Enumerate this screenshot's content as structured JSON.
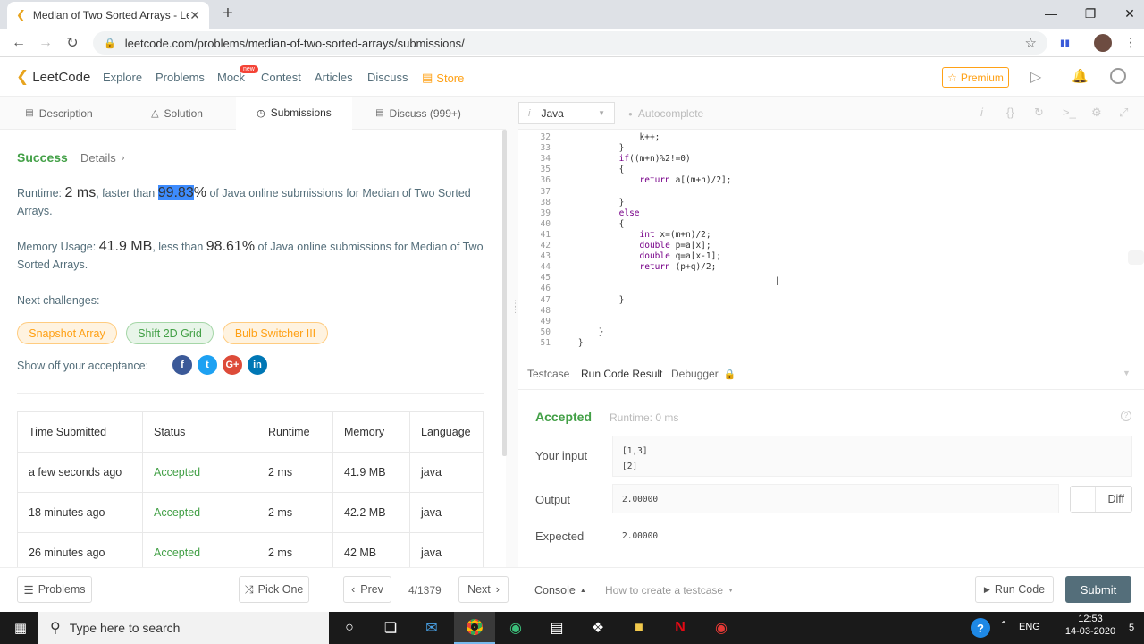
{
  "browser": {
    "tab_title": "Median of Two Sorted Arrays - Le",
    "url": "leetcode.com/problems/median-of-two-sorted-arrays/submissions/"
  },
  "nav": {
    "logo": "LeetCode",
    "explore": "Explore",
    "problems": "Problems",
    "mock": "Mock",
    "badge": "new",
    "contest": "Contest",
    "articles": "Articles",
    "discuss": "Discuss",
    "store": "Store",
    "premium": "Premium"
  },
  "subtabs": {
    "description": "Description",
    "solution": "Solution",
    "submissions": "Submissions",
    "discuss": "Discuss (999+)"
  },
  "editor": {
    "language": "Java",
    "autocomplete": "Autocomplete",
    "lines": [
      {
        "n": "32",
        "t": "                k++;"
      },
      {
        "n": "33",
        "t": "            }"
      },
      {
        "n": "34",
        "t": "            if((m+n)%2!=0)"
      },
      {
        "n": "35",
        "t": "            {"
      },
      {
        "n": "36",
        "t": "                return a[(m+n)/2];"
      },
      {
        "n": "37",
        "t": ""
      },
      {
        "n": "38",
        "t": "            }"
      },
      {
        "n": "39",
        "t": "            else"
      },
      {
        "n": "40",
        "t": "            {"
      },
      {
        "n": "41",
        "t": "                int x=(m+n)/2;"
      },
      {
        "n": "42",
        "t": "                double p=a[x];"
      },
      {
        "n": "43",
        "t": "                double q=a[x-1];"
      },
      {
        "n": "44",
        "t": "                return (p+q)/2;"
      },
      {
        "n": "45",
        "t": ""
      },
      {
        "n": "46",
        "t": ""
      },
      {
        "n": "47",
        "t": "            }"
      },
      {
        "n": "48",
        "t": ""
      },
      {
        "n": "49",
        "t": ""
      },
      {
        "n": "50",
        "t": "        }"
      },
      {
        "n": "51",
        "t": "    }"
      }
    ]
  },
  "result": {
    "success": "Success",
    "details": "Details",
    "runtime_label": "Runtime:",
    "runtime_value": "2 ms",
    "faster_than": ", faster than",
    "runtime_pct": "99.83",
    "pct_sign": "%",
    "runtime_tail": "of Java online submissions for Median of Two Sorted Arrays.",
    "memory_label": "Memory Usage:",
    "memory_value": "41.9 MB",
    "less_than": ", less than",
    "memory_pct": "98.61%",
    "memory_tail": "of Java online submissions for Median of Two Sorted Arrays.",
    "next_challenges": "Next challenges:",
    "challenges": [
      "Snapshot Array",
      "Shift 2D Grid",
      "Bulb Switcher III"
    ],
    "show_off": "Show off your acceptance:"
  },
  "table": {
    "headers": [
      "Time Submitted",
      "Status",
      "Runtime",
      "Memory",
      "Language"
    ],
    "rows": [
      [
        "a few seconds ago",
        "Accepted",
        "2 ms",
        "41.9 MB",
        "java"
      ],
      [
        "18 minutes ago",
        "Accepted",
        "2 ms",
        "42.2 MB",
        "java"
      ],
      [
        "26 minutes ago",
        "Accepted",
        "2 ms",
        "42 MB",
        "java"
      ]
    ]
  },
  "console": {
    "tabs": [
      "Testcase",
      "Run Code Result",
      "Debugger"
    ],
    "status": "Accepted",
    "runtime": "Runtime: 0 ms",
    "your_input": "Your input",
    "input_lines": [
      "[1,3]",
      "[2]"
    ],
    "output_label": "Output",
    "output": "2.00000",
    "expected_label": "Expected",
    "expected": "2.00000",
    "diff": "Diff"
  },
  "bottom": {
    "problems": "Problems",
    "pick_one": "Pick One",
    "prev": "Prev",
    "counter": "4/1379",
    "next": "Next",
    "console": "Console",
    "howto": "How to create a testcase",
    "run": "Run Code",
    "submit": "Submit"
  },
  "taskbar": {
    "search": "Type here to search",
    "lang": "ENG",
    "time": "12:53",
    "date": "14-03-2020",
    "notif": "5"
  }
}
